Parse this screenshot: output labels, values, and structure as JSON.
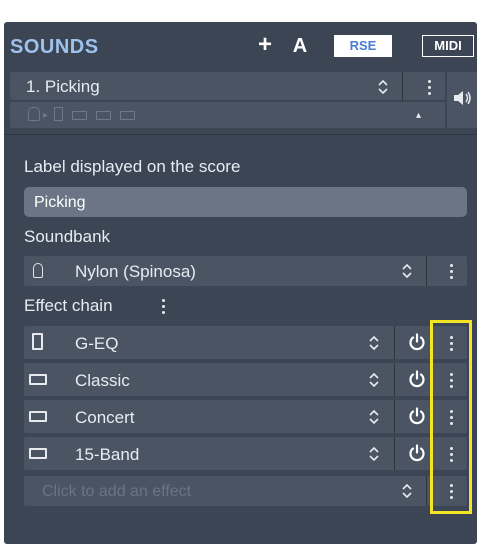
{
  "header": {
    "title": "SOUNDS",
    "add_symbol": "+",
    "auto_symbol": "A",
    "rse_label": "RSE",
    "midi_label": "MIDI"
  },
  "sound": {
    "name": "1. Picking",
    "chevron": "⌃⌄",
    "collapse_symbol": "▴"
  },
  "label_section": {
    "heading": "Label displayed on the score",
    "value": "Picking"
  },
  "soundbank": {
    "heading": "Soundbank",
    "value": "Nylon (Spinosa)"
  },
  "effect_chain": {
    "heading": "Effect chain",
    "items": [
      {
        "label": "G-EQ",
        "icon": "eq-box-icon"
      },
      {
        "label": "Classic",
        "icon": "amp-icon"
      },
      {
        "label": "Concert",
        "icon": "amp-icon"
      },
      {
        "label": "15-Band",
        "icon": "amp-icon"
      }
    ],
    "placeholder": "Click to add an effect"
  },
  "colors": {
    "panel": "#3b4553",
    "row": "#4a5462",
    "title_blue": "#9fc2ec",
    "highlight": "#f3e523"
  }
}
